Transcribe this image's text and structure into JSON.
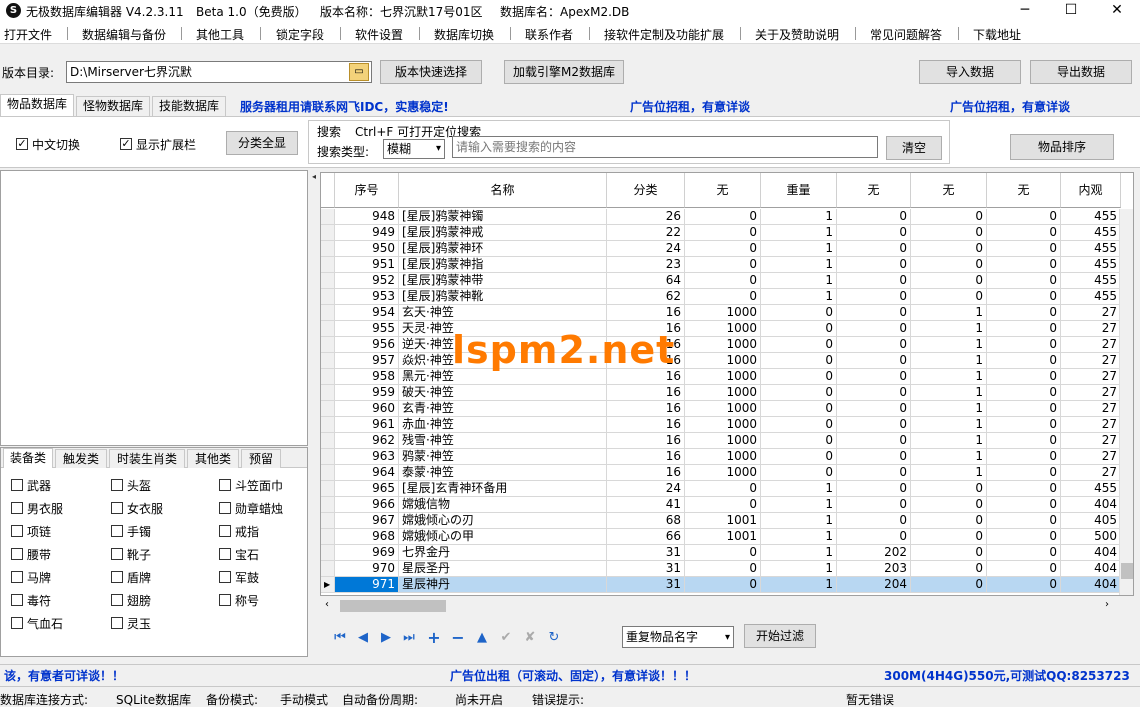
{
  "window": {
    "title": "无极数据库编辑器 V4.2.3.11",
    "beta": "Beta 1.0（免费版）",
    "version_name": "版本名称：七界沉默17号01区",
    "db_name": "数据库名：ApexM2.DB",
    "logo_char": "S",
    "min": "─",
    "max": "☐",
    "close": "✕"
  },
  "menu": [
    "打开文件",
    "数据编辑与备份",
    "其他工具",
    "锁定字段",
    "软件设置",
    "数据库切换",
    "联系作者",
    "接软件定制及功能扩展",
    "关于及赞助说明",
    "常见问题解答",
    "下载地址"
  ],
  "toolbar": {
    "dir_label": "版本目录:",
    "dir_value": "D:\\Mirserver七界沉默",
    "quick_select": "版本快速选择",
    "load_engine": "加载引擎M2数据库",
    "import": "导入数据",
    "export": "导出数据"
  },
  "tabs": [
    "物品数据库",
    "怪物数据库",
    "技能数据库"
  ],
  "banners": {
    "b1": "服务器租用请联系网飞IDC，实惠稳定!",
    "b2": "广告位招租，有意详谈",
    "b3": "广告位招租，有意详谈"
  },
  "options": {
    "cn_switch": "中文切换",
    "show_ext": "显示扩展栏",
    "show_all": "分类全显",
    "search_title": "搜索",
    "search_hint": "Ctrl+F 可打开定位搜索",
    "search_type_label": "搜索类型:",
    "search_type_value": "模糊",
    "search_placeholder": "请输入需要搜索的内容",
    "clear": "清空",
    "sort": "物品排序"
  },
  "category_tabs": [
    "装备类",
    "触发类",
    "时装生肖类",
    "其他类",
    "预留"
  ],
  "categories": [
    "武器",
    "头盔",
    "斗笠面巾",
    "男衣服",
    "女衣服",
    "勋章蜡烛",
    "项链",
    "手镯",
    "戒指",
    "腰带",
    "靴子",
    "宝石",
    "马牌",
    "盾牌",
    "军鼓",
    "毒符",
    "翅膀",
    "称号",
    "气血石",
    "灵玉"
  ],
  "grid": {
    "headers": [
      "序号",
      "名称",
      "分类",
      "无",
      "重量",
      "无",
      "无",
      "无",
      "内观"
    ],
    "rows": [
      [
        "948",
        "[星辰]鸦蒙神镯",
        "26",
        "0",
        "1",
        "0",
        "0",
        "0",
        "455"
      ],
      [
        "949",
        "[星辰]鸦蒙神戒",
        "22",
        "0",
        "1",
        "0",
        "0",
        "0",
        "455"
      ],
      [
        "950",
        "[星辰]鸦蒙神环",
        "24",
        "0",
        "1",
        "0",
        "0",
        "0",
        "455"
      ],
      [
        "951",
        "[星辰]鸦蒙神指",
        "23",
        "0",
        "1",
        "0",
        "0",
        "0",
        "455"
      ],
      [
        "952",
        "[星辰]鸦蒙神带",
        "64",
        "0",
        "1",
        "0",
        "0",
        "0",
        "455"
      ],
      [
        "953",
        "[星辰]鸦蒙神靴",
        "62",
        "0",
        "1",
        "0",
        "0",
        "0",
        "455"
      ],
      [
        "954",
        "玄天·神笠",
        "16",
        "1000",
        "0",
        "0",
        "1",
        "0",
        "27"
      ],
      [
        "955",
        "天灵·神笠",
        "16",
        "1000",
        "0",
        "0",
        "1",
        "0",
        "27"
      ],
      [
        "956",
        "逆天·神笠",
        "16",
        "1000",
        "0",
        "0",
        "1",
        "0",
        "27"
      ],
      [
        "957",
        "焱炽·神笠",
        "16",
        "1000",
        "0",
        "0",
        "1",
        "0",
        "27"
      ],
      [
        "958",
        "黑元·神笠",
        "16",
        "1000",
        "0",
        "0",
        "1",
        "0",
        "27"
      ],
      [
        "959",
        "破天·神笠",
        "16",
        "1000",
        "0",
        "0",
        "1",
        "0",
        "27"
      ],
      [
        "960",
        "玄青·神笠",
        "16",
        "1000",
        "0",
        "0",
        "1",
        "0",
        "27"
      ],
      [
        "961",
        "赤血·神笠",
        "16",
        "1000",
        "0",
        "0",
        "1",
        "0",
        "27"
      ],
      [
        "962",
        "残雪·神笠",
        "16",
        "1000",
        "0",
        "0",
        "1",
        "0",
        "27"
      ],
      [
        "963",
        "鸦蒙·神笠",
        "16",
        "1000",
        "0",
        "0",
        "1",
        "0",
        "27"
      ],
      [
        "964",
        "泰蒙·神笠",
        "16",
        "1000",
        "0",
        "0",
        "1",
        "0",
        "27"
      ],
      [
        "965",
        "[星辰]玄青神环备用",
        "24",
        "0",
        "1",
        "0",
        "0",
        "0",
        "455"
      ],
      [
        "966",
        "嫦娥信物",
        "41",
        "0",
        "1",
        "0",
        "0",
        "0",
        "404"
      ],
      [
        "967",
        "嫦娥倾心の刃",
        "68",
        "1001",
        "1",
        "0",
        "0",
        "0",
        "405"
      ],
      [
        "968",
        "嫦娥倾心の甲",
        "66",
        "1001",
        "1",
        "0",
        "0",
        "0",
        "500"
      ],
      [
        "969",
        "七界金丹",
        "31",
        "0",
        "1",
        "202",
        "0",
        "0",
        "404"
      ],
      [
        "970",
        "星辰圣丹",
        "31",
        "0",
        "1",
        "203",
        "0",
        "0",
        "404"
      ],
      [
        "971",
        "星辰神丹",
        "31",
        "0",
        "1",
        "204",
        "0",
        "0",
        "404"
      ]
    ]
  },
  "watermark": "lspm2.net",
  "filter": {
    "dup_value": "重复物品名字",
    "start": "开始过滤"
  },
  "bottom_banner": {
    "left": "该，有意者可详谈！！",
    "center": "广告位出租（可滚动、固定），有意详谈！！！",
    "right": "300M(4H4G)550元,可测试QQ:8253723"
  },
  "status": {
    "conn_label": "数据库连接方式:",
    "conn_value": "SQLite数据库",
    "backup_label": "备份模式:",
    "backup_value": "手动模式",
    "auto_label": "自动备份周期:",
    "auto_value": "尚未开启",
    "err_label": "错误提示:",
    "err_value": "暂无错误"
  },
  "colors": {
    "banner_blue": "#0033cc",
    "select_blue": "#0078d7",
    "watermark_orange": "#ff7a00"
  }
}
